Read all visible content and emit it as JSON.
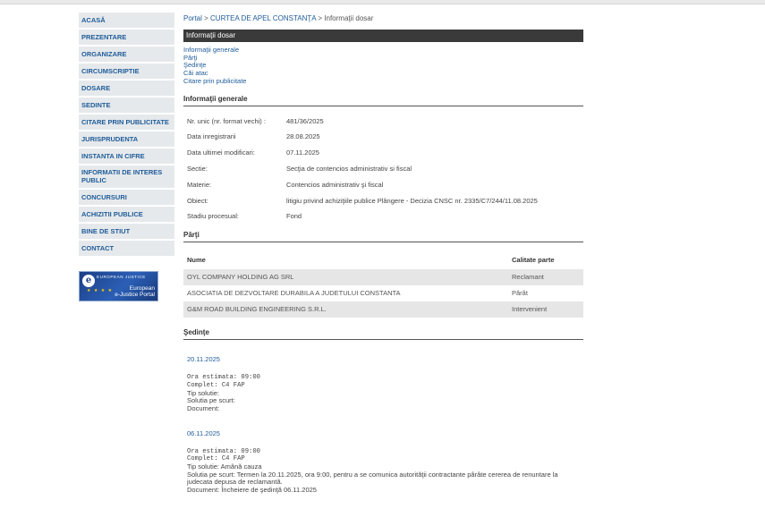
{
  "sidebar": {
    "items": [
      {
        "label": "ACASĂ"
      },
      {
        "label": "PREZENTARE"
      },
      {
        "label": "ORGANIZARE"
      },
      {
        "label": "CIRCUMSCRIPTIE"
      },
      {
        "label": "DOSARE"
      },
      {
        "label": "SEDINTE"
      },
      {
        "label": "CITARE PRIN PUBLICITATE"
      },
      {
        "label": "JURISPRUDENTA"
      },
      {
        "label": "INSTANTA IN CIFRE"
      },
      {
        "label": "INFORMATII DE INTERES PUBLIC"
      },
      {
        "label": "CONCURSURI"
      },
      {
        "label": "ACHIZITII PUBLICE"
      },
      {
        "label": "BINE DE STIUT"
      },
      {
        "label": "CONTACT"
      }
    ],
    "banner": {
      "top_text": "EUROPEAN JUSTICE",
      "bottom_line1": "European",
      "bottom_line2": "e-Justice Portal"
    }
  },
  "breadcrumb": {
    "portal": "Portal",
    "sep1": " > ",
    "court": "CURTEA DE APEL CONSTANŢA",
    "sep2": " > ",
    "current": "Informaţii dosar"
  },
  "header": {
    "title": "Informaţii dosar"
  },
  "quick_links": [
    "Informaţii generale",
    "Părţi",
    "Şedinţe",
    "Căi atac",
    "Citare prin publicitate"
  ],
  "info": {
    "title": "Informaţii generale",
    "rows": [
      {
        "label": "Nr. unic (nr. format vechi) :",
        "value": "481/36/2025"
      },
      {
        "label": "Data inregistrarii",
        "value": "28.08.2025"
      },
      {
        "label": "Data ultimei modificari:",
        "value": "07.11.2025"
      },
      {
        "label": "Sectie:",
        "value": "Secţia de contencios administrativ si fiscal"
      },
      {
        "label": "Materie:",
        "value": "Contencios administrativ şi fiscal"
      },
      {
        "label": "Obiect:",
        "value": "litigiu privind achiziţiile publice Plângere - Decizia CNSC nr. 2335/C7/244/11.08.2025"
      },
      {
        "label": "Stadiu procesual:",
        "value": "Fond"
      }
    ]
  },
  "parti": {
    "title": "Părţi",
    "headers": {
      "name": "Nume",
      "calitate": "Calitate parte"
    },
    "rows": [
      {
        "name": "OYL COMPANY HOLDING AG SRL",
        "calitate": "Reclamant"
      },
      {
        "name": "ASOCIATIA DE DEZVOLTARE DURABILA A JUDETULUI CONSTANTA",
        "calitate": "Pârât"
      },
      {
        "name": "G&M ROAD BUILDING ENGINEERING S.R.L.",
        "calitate": "Intervenient"
      }
    ]
  },
  "sedinte": {
    "title": "Şedinţe",
    "items": [
      {
        "date": "20.11.2025",
        "ora": "Ora estimata: 09:00",
        "complet": "Complet: C4 FAP",
        "tip": "Tip solutie:",
        "solutia": "Solutia pe scurt:",
        "solutia2": "",
        "document": "Document:"
      },
      {
        "date": "06.11.2025",
        "ora": "Ora estimata: 09:00",
        "complet": "Complet: C4 FAP",
        "tip": "Tip solutie: Amână cauza",
        "solutia": "Solutia pe scurt: Termen la 20.11.2025, ora 9:00, pentru a se comunica autorităţii contractante pârâte cererea de renuntare la",
        "solutia2": "judecata depusa de reclamantă.",
        "document": "Document: Încheiere de şedinţă    06.11.2025"
      }
    ]
  }
}
